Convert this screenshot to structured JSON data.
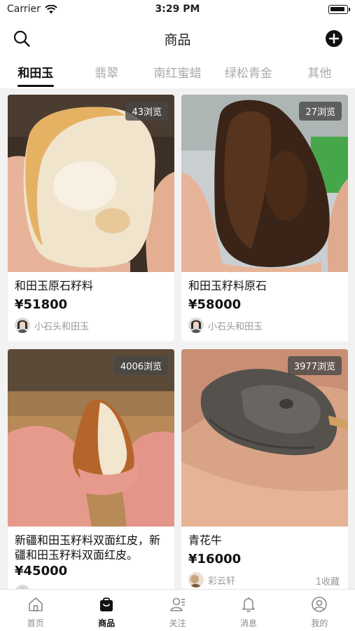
{
  "status_bar": {
    "carrier": "Carrier",
    "time": "3:29 PM"
  },
  "nav": {
    "title": "商品"
  },
  "tabs": [
    {
      "label": "和田玉",
      "active": true
    },
    {
      "label": "翡翠",
      "active": false
    },
    {
      "label": "南红蜜蜡",
      "active": false
    },
    {
      "label": "绿松青金",
      "active": false
    },
    {
      "label": "其他",
      "active": false
    }
  ],
  "products": [
    {
      "views": "43浏览",
      "name": "和田玉原石籽料",
      "price": "¥51800",
      "seller": "小石头和田玉",
      "favorites": ""
    },
    {
      "views": "27浏览",
      "name": "和田玉籽料原石",
      "price": "¥58000",
      "seller": "小石头和田玉",
      "favorites": ""
    },
    {
      "views": "4006浏览",
      "name": "新疆和田玉籽料双面红皮，新疆和田玉籽料双面红皮。",
      "price": "¥45000",
      "seller": "",
      "favorites": ""
    },
    {
      "views": "3977浏览",
      "name": "青花牛",
      "price": "¥16000",
      "seller": "彩云轩",
      "favorites": "1收藏"
    }
  ],
  "tab_bar": [
    {
      "label": "首页",
      "icon": "home-icon",
      "active": false
    },
    {
      "label": "商品",
      "icon": "shopping-bag-icon",
      "active": true
    },
    {
      "label": "关注",
      "icon": "follow-user-icon",
      "active": false
    },
    {
      "label": "消息",
      "icon": "bell-icon",
      "active": false
    },
    {
      "label": "我的",
      "icon": "profile-icon",
      "active": false
    }
  ]
}
